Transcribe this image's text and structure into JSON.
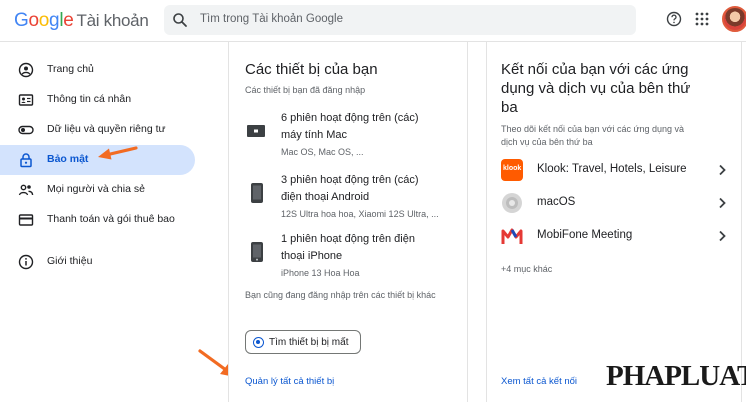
{
  "header": {
    "logo": {
      "g1": "G",
      "g2": "o",
      "g3": "o",
      "g4": "g",
      "g5": "l",
      "g6": "e",
      "product": "Tài khoản"
    },
    "search_placeholder": "Tìm trong Tài khoản Google",
    "icons": [
      "search-icon",
      "help-icon",
      "apps-grid-icon",
      "avatar"
    ]
  },
  "sidebar": {
    "items": [
      {
        "label": "Trang chủ",
        "icon": "home-icon"
      },
      {
        "label": "Thông tin cá nhân",
        "icon": "id-card-icon"
      },
      {
        "label": "Dữ liệu và quyền riêng tư",
        "icon": "toggle-icon"
      },
      {
        "label": "Bảo mật",
        "icon": "lock-icon",
        "active": true
      },
      {
        "label": "Mọi người và chia sẻ",
        "icon": "people-icon"
      },
      {
        "label": "Thanh toán và gói thuê bao",
        "icon": "credit-card-icon"
      },
      {
        "label": "Giới thiệu",
        "icon": "info-icon"
      }
    ]
  },
  "devices": {
    "title": "Các thiết bị của bạn",
    "subtitle": "Các thiết bị bạn đã đăng nhập",
    "groups": [
      {
        "line1": "6 phiên hoạt động trên (các)",
        "line2": "máy tính Mac",
        "meta": "Mac OS, Mac OS, ...",
        "icon": "laptop-icon"
      },
      {
        "line1": "3 phiên hoạt động trên (các)",
        "line2": "điện thoại Android",
        "meta": "12S Ultra hoa hoa, Xiaomi 12S Ultra, ...",
        "icon": "android-phone-icon"
      },
      {
        "line1": "1 phiên hoạt động trên điện",
        "line2": "thoại iPhone",
        "meta": "iPhone 13 Hoa Hoa",
        "icon": "iphone-icon"
      }
    ],
    "note": "Bạn cũng đang đăng nhập trên các thiết bị khác",
    "find_button": "Tìm thiết bị bị mất",
    "manage_link": "Quản lý tất cả thiết bị"
  },
  "connections": {
    "title_lines": [
      "Kết nối của bạn với các ứng",
      "dụng và dịch vụ của bên thứ",
      "ba"
    ],
    "subtitle_lines": [
      "Theo dõi kết nối của bạn với các ứng dụng và",
      "dịch vụ của bên thứ ba"
    ],
    "apps": [
      {
        "name": "Klook: Travel, Hotels, Leisure",
        "icon": "klook-icon",
        "icon_text": "klook",
        "color": "#ff5b00"
      },
      {
        "name": "macOS",
        "icon": "macos-icon",
        "color": "#bdbdbd"
      },
      {
        "name": "MobiFone Meeting",
        "icon": "mobifone-icon",
        "color": "#e53935"
      }
    ],
    "more": "+4 mục khác",
    "view_all_link": "Xem tất cả kết nối"
  },
  "watermark": "PHAPLUAT",
  "colors": {
    "accent": "#0b57d0",
    "active_bg": "#d3e3fd",
    "arrow": "#f26b22"
  }
}
